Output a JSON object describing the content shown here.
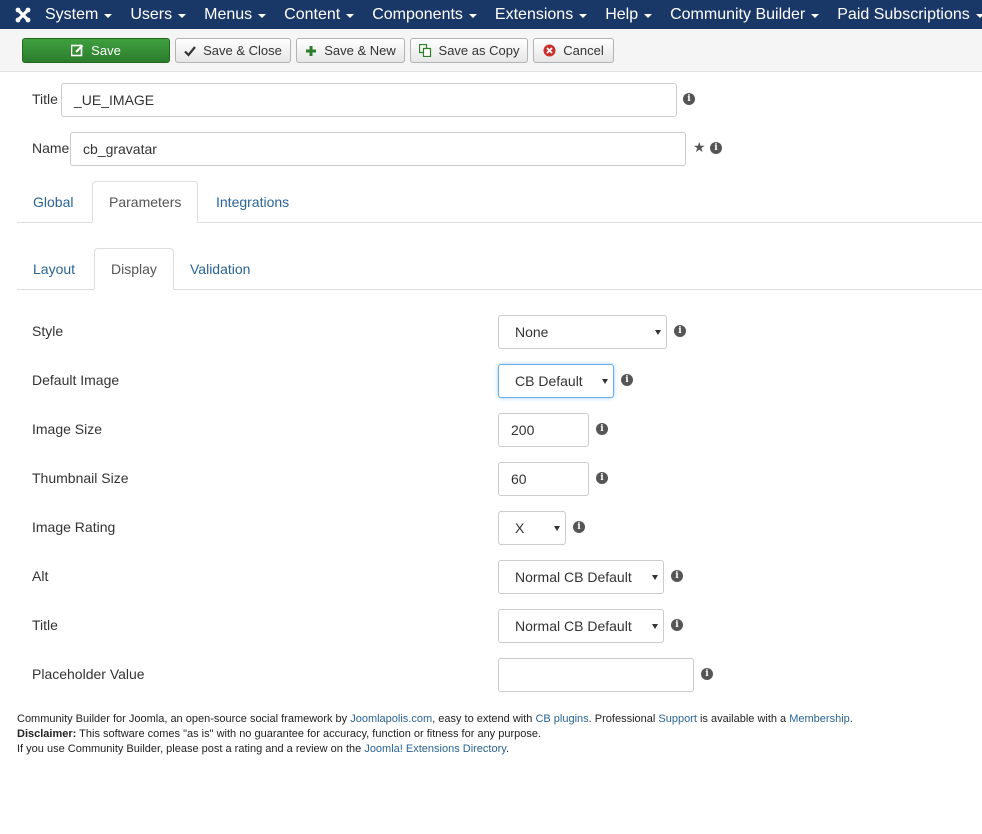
{
  "nav": {
    "items": [
      "System",
      "Users",
      "Menus",
      "Content",
      "Components",
      "Extensions",
      "Help"
    ],
    "right_items": [
      "Community Builder",
      "Paid Subscriptions"
    ]
  },
  "toolbar": {
    "save": "Save",
    "save_close": "Save & Close",
    "save_new": "Save & New",
    "save_copy": "Save as Copy",
    "cancel": "Cancel"
  },
  "fields": {
    "title_label": "Title",
    "title_value": "_UE_IMAGE",
    "name_label": "Name",
    "name_value": "cb_gravatar"
  },
  "tabs": {
    "main": [
      "Global",
      "Parameters",
      "Integrations"
    ],
    "sub": [
      "Layout",
      "Display",
      "Validation"
    ]
  },
  "display": {
    "style_label": "Style",
    "style_value": "None",
    "default_image_label": "Default Image",
    "default_image_value": "CB Default",
    "image_size_label": "Image Size",
    "image_size_value": "200",
    "thumb_size_label": "Thumbnail Size",
    "thumb_size_value": "60",
    "rating_label": "Image Rating",
    "rating_value": "X",
    "alt_label": "Alt",
    "alt_value": "Normal CB Default",
    "title_label": "Title",
    "title_value": "Normal CB Default",
    "placeholder_label": "Placeholder Value",
    "placeholder_value": ""
  },
  "footer": {
    "l1_a": "Community Builder for Joomla, an open-source social framework by ",
    "l1_link1": "Joomlapolis.com",
    "l1_b": ", easy to extend with ",
    "l1_link2": "CB plugins",
    "l1_c": ". Professional ",
    "l1_link3": "Support",
    "l1_d": " is available with a ",
    "l1_link4": "Membership",
    "l1_e": ".",
    "l2_bold": "Disclaimer:",
    "l2_text": " This software comes \"as is\" with no guarantee for accuracy, function or fitness for any purpose.",
    "l3_text": "If you use Community Builder, please post a rating and a review on the ",
    "l3_link": "Joomla! Extensions Directory",
    "l3_end": "."
  }
}
